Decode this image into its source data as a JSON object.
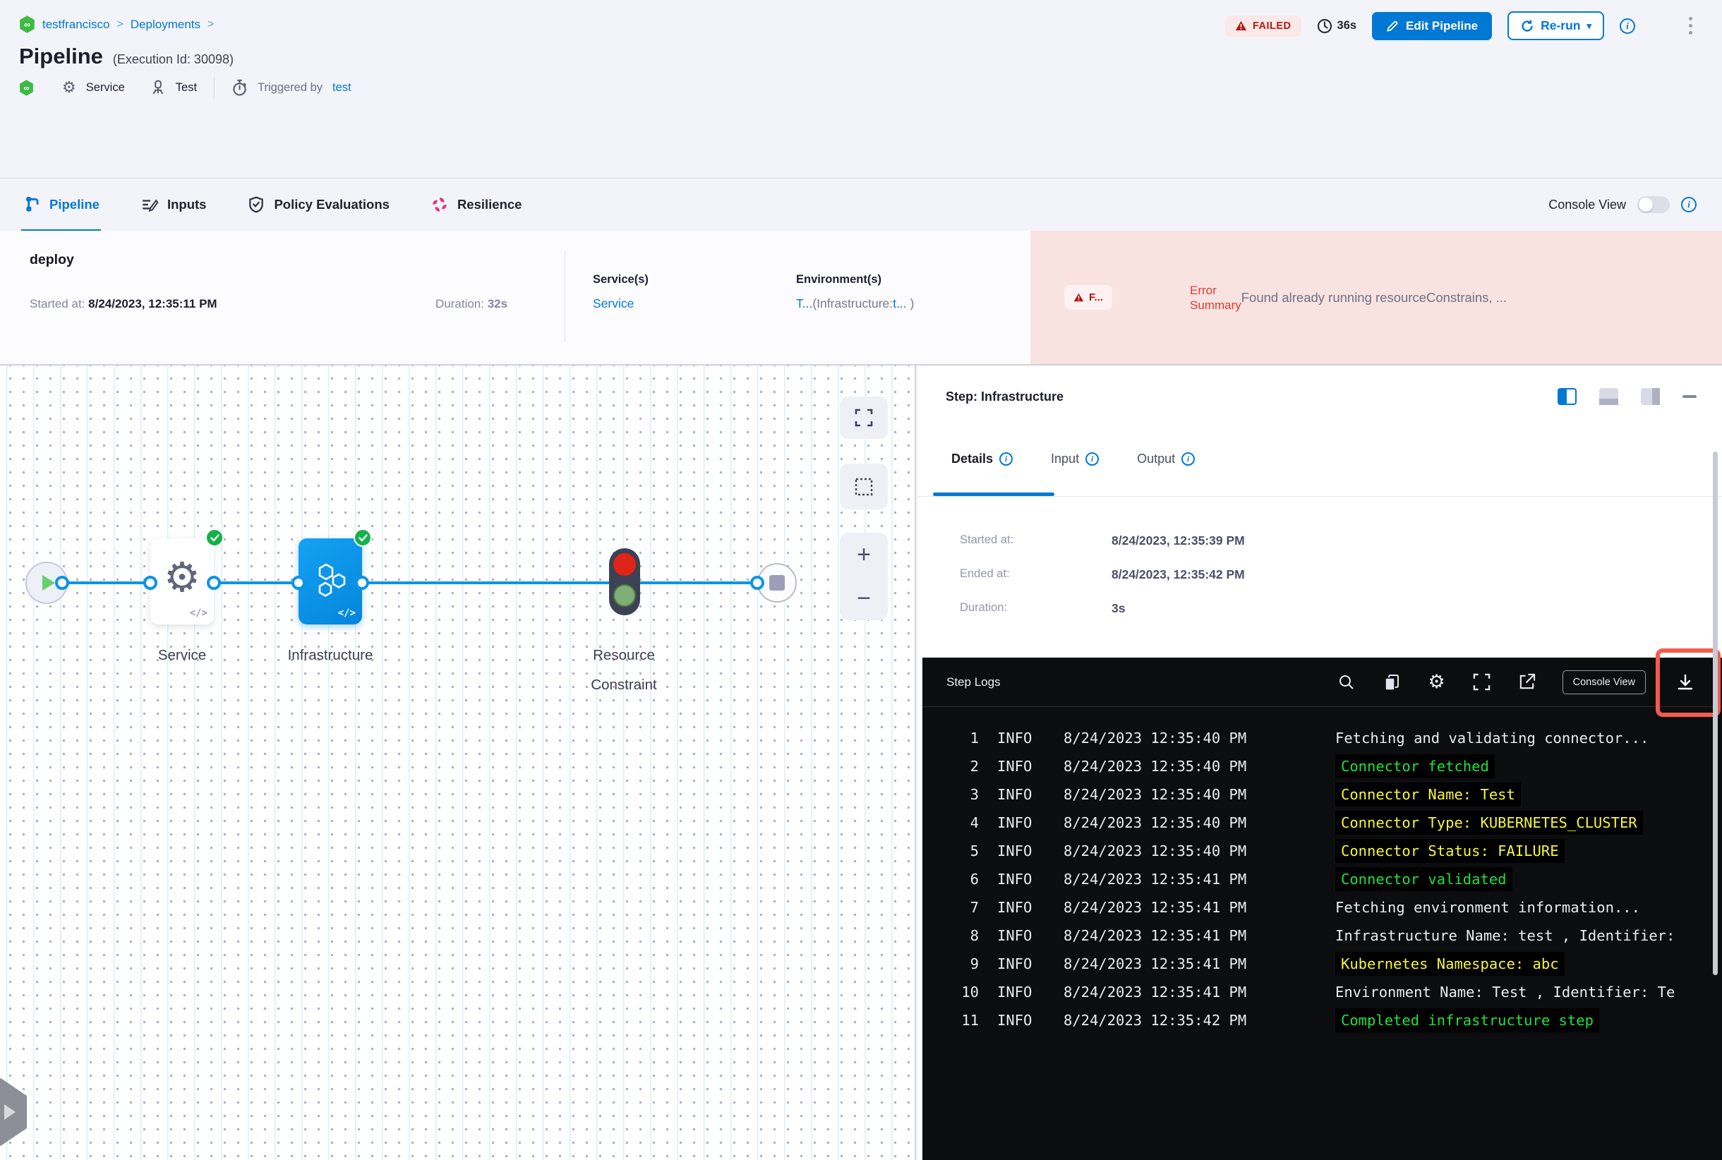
{
  "breadcrumb": {
    "project": "testfrancisco",
    "section": "Deployments",
    "separator": ">"
  },
  "header": {
    "title": "Pipeline",
    "execution_id": "(Execution Id: 30098)",
    "status_badge": "FAILED",
    "total_duration": "36s",
    "edit_pipeline_label": "Edit Pipeline",
    "rerun_label": "Re-run",
    "tags": {
      "module": "Service",
      "environment": "Test",
      "triggered_by_label": "Triggered by",
      "triggered_by_user": "test"
    }
  },
  "tabs": {
    "pipeline": "Pipeline",
    "inputs": "Inputs",
    "policy": "Policy Evaluations",
    "resilience": "Resilience",
    "console_view_label": "Console View"
  },
  "stage": {
    "name": "deploy",
    "started_label": "Started at: ",
    "started_value": "8/24/2023, 12:35:11 PM",
    "duration_label": "Duration: ",
    "duration_value": "32s",
    "services_label": "Service(s)",
    "service_value": "Service",
    "environments_label": "Environment(s)",
    "env_part1": "T...",
    "env_part2": "(Infrastructure:",
    "env_part3": "t...",
    "env_part4": " )",
    "error_badge": "F...",
    "error_label_line1": "Error",
    "error_label_line2": "Summary",
    "error_message": "Found already running resourceConstrains, ..."
  },
  "graph": {
    "node1_label": "Service",
    "node2_label": "Infrastructure",
    "node3_label_line1": "Resource",
    "node3_label_line2": "Constraint"
  },
  "step_panel": {
    "title": "Step: Infrastructure",
    "tab_details": "Details",
    "tab_input": "Input",
    "tab_output": "Output",
    "started_label": "Started at:",
    "started_value": "8/24/2023, 12:35:39 PM",
    "ended_label": "Ended at:",
    "ended_value": "8/24/2023, 12:35:42 PM",
    "duration_label": "Duration:",
    "duration_value": "3s"
  },
  "logs": {
    "title": "Step Logs",
    "console_view_button": "Console View",
    "lines": [
      {
        "num": "1",
        "level": "INFO",
        "time": "8/24/2023 12:35:40 PM",
        "message": "Fetching and validating connector...",
        "color": "white",
        "highlight": false
      },
      {
        "num": "2",
        "level": "INFO",
        "time": "8/24/2023 12:35:40 PM",
        "message": "Connector fetched",
        "color": "green",
        "highlight": true
      },
      {
        "num": "3",
        "level": "INFO",
        "time": "8/24/2023 12:35:40 PM",
        "message": "Connector Name: Test",
        "color": "yellow",
        "highlight": true
      },
      {
        "num": "4",
        "level": "INFO",
        "time": "8/24/2023 12:35:40 PM",
        "message": "Connector Type: KUBERNETES_CLUSTER",
        "color": "yellow",
        "highlight": true
      },
      {
        "num": "5",
        "level": "INFO",
        "time": "8/24/2023 12:35:40 PM",
        "message": "Connector Status: FAILURE",
        "color": "yellow",
        "highlight": true
      },
      {
        "num": "6",
        "level": "INFO",
        "time": "8/24/2023 12:35:41 PM",
        "message": "Connector validated",
        "color": "green",
        "highlight": true
      },
      {
        "num": "7",
        "level": "INFO",
        "time": "8/24/2023 12:35:41 PM",
        "message": "Fetching environment information...",
        "color": "white",
        "highlight": false
      },
      {
        "num": "8",
        "level": "INFO",
        "time": "8/24/2023 12:35:41 PM",
        "message": "Infrastructure Name: test , Identifier:",
        "color": "white",
        "highlight": false
      },
      {
        "num": "9",
        "level": "INFO",
        "time": "8/24/2023 12:35:41 PM",
        "message": "Kubernetes Namespace: abc",
        "color": "yellow",
        "highlight": true
      },
      {
        "num": "10",
        "level": "INFO",
        "time": "8/24/2023 12:35:41 PM",
        "message": "Environment Name: Test , Identifier: Te",
        "color": "white",
        "highlight": false
      },
      {
        "num": "11",
        "level": "INFO",
        "time": "8/24/2023 12:35:42 PM",
        "message": "Completed infrastructure step",
        "color": "green",
        "highlight": true
      }
    ]
  },
  "icons": {
    "gear": "⚙",
    "caret_down": "▾",
    "infinity": "∞",
    "code": "</>",
    "plus": "+",
    "minus": "−",
    "i": "i"
  },
  "colors": {
    "primary_blue": "#0278d5",
    "failed_red": "#b01c15",
    "error_bg": "#f9e3e1",
    "log_green": "#1ee339",
    "log_yellow": "#f6f63c",
    "highlight_red": "#f25c4e",
    "node_blue": "#0b94ea",
    "success_green": "#16b04b"
  }
}
